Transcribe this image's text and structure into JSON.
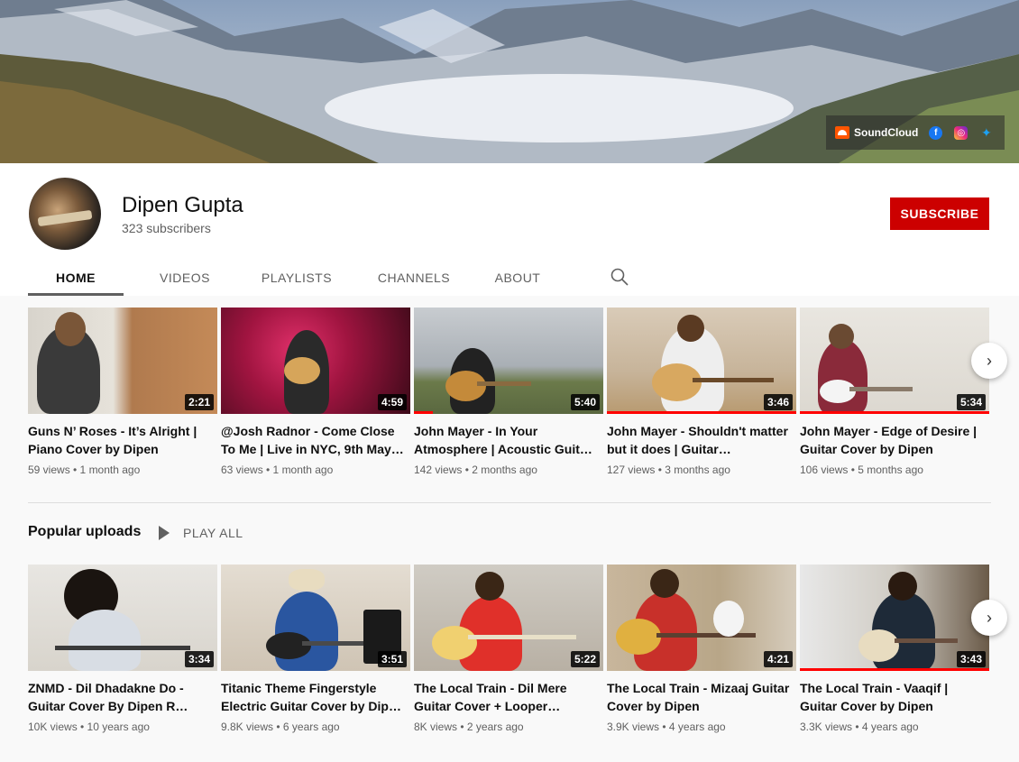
{
  "banner": {
    "links": {
      "soundcloud_label": "SoundCloud",
      "facebook_icon": "facebook-icon",
      "instagram_icon": "instagram-icon",
      "twitter_icon": "twitter-icon"
    }
  },
  "channel": {
    "name": "Dipen Gupta",
    "subscribers": "323 subscribers",
    "subscribe_label": "SUBSCRIBE"
  },
  "tabs": [
    {
      "label": "HOME",
      "active": true
    },
    {
      "label": "VIDEOS",
      "active": false
    },
    {
      "label": "PLAYLISTS",
      "active": false
    },
    {
      "label": "CHANNELS",
      "active": false
    },
    {
      "label": "ABOUT",
      "active": false
    }
  ],
  "shelf1": {
    "videos": [
      {
        "title": "Guns N’ Roses - It’s Alright | Piano Cover by Dipen",
        "meta": "59 views • 1 month ago",
        "duration": "2:21",
        "progress": 0
      },
      {
        "title": "@Josh Radnor - Come Close To Me | Live in NYC, 9th May…",
        "meta": "63 views • 1 month ago",
        "duration": "4:59",
        "progress": 0
      },
      {
        "title": "John Mayer - In Your Atmosphere | Acoustic Guit…",
        "meta": "142 views • 2 months ago",
        "duration": "5:40",
        "progress": 0.1
      },
      {
        "title": "John Mayer - Shouldn't matter but it does | Guitar…",
        "meta": "127 views • 3 months ago",
        "duration": "3:46",
        "progress": 1.0
      },
      {
        "title": "John Mayer - Edge of Desire | Guitar Cover by Dipen",
        "meta": "106 views • 5 months ago",
        "duration": "5:34",
        "progress": 1.0
      }
    ]
  },
  "shelf2": {
    "title": "Popular uploads",
    "play_all_label": "PLAY ALL",
    "videos": [
      {
        "title": "ZNMD - Dil Dhadakne Do - Guitar Cover By Dipen R…",
        "meta": "10K views • 10 years ago",
        "duration": "3:34",
        "progress": 0
      },
      {
        "title": "Titanic Theme Fingerstyle Electric Guitar Cover by Dip…",
        "meta": "9.8K views • 6 years ago",
        "duration": "3:51",
        "progress": 0
      },
      {
        "title": "The Local Train - Dil Mere Guitar Cover + Looper…",
        "meta": "8K views • 2 years ago",
        "duration": "5:22",
        "progress": 0
      },
      {
        "title": "The Local Train - Mizaaj Guitar Cover by Dipen",
        "meta": "3.9K views • 4 years ago",
        "duration": "4:21",
        "progress": 0
      },
      {
        "title": "The Local Train - Vaaqif | Guitar Cover by Dipen",
        "meta": "3.3K views • 4 years ago",
        "duration": "3:43",
        "progress": 1.0
      }
    ]
  },
  "colors": {
    "subscribe": "#cc0000",
    "progress": "#ff0000",
    "meta": "#606060"
  }
}
